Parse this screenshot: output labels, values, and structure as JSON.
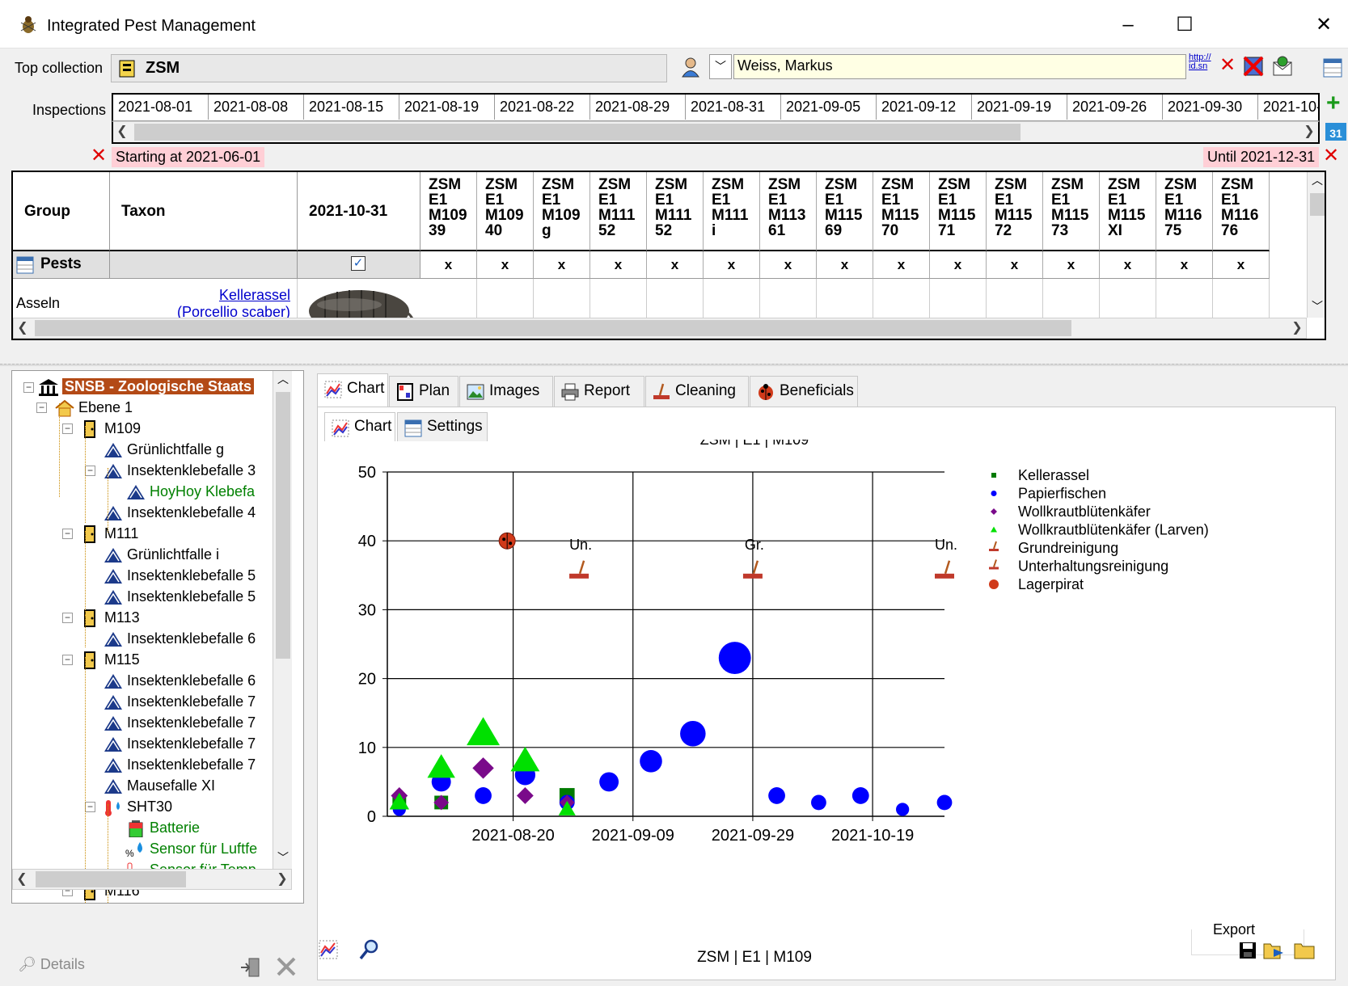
{
  "window": {
    "title": "Integrated Pest Management",
    "minimize": "–",
    "maximize": "☐",
    "close": "✕"
  },
  "top_collection": {
    "label": "Top collection",
    "value": "ZSM"
  },
  "user": {
    "value": "Weiss, Markus",
    "link_text": "http://\nid.sn"
  },
  "inspections": {
    "label": "Inspections",
    "dates": [
      "2021-08-01",
      "2021-08-08",
      "2021-08-15",
      "2021-08-19",
      "2021-08-22",
      "2021-08-29",
      "2021-08-31",
      "2021-09-05",
      "2021-09-12",
      "2021-09-19",
      "2021-09-26",
      "2021-09-30",
      "2021-10-"
    ]
  },
  "filter": {
    "start": "Starting at 2021-06-01",
    "end": "Until 2021-12-31"
  },
  "grid": {
    "col_group": "Group",
    "col_taxon": "Taxon",
    "col_date": "2021-10-31",
    "trap_columns": [
      "ZSM\nE1\nM109\n39",
      "ZSM\nE1\nM109\n40",
      "ZSM\nE1\nM109\ng",
      "ZSM\nE1\nM111\n52",
      "ZSM\nE1\nM111\n52",
      "ZSM\nE1\nM111\ni",
      "ZSM\nE1\nM113\n61",
      "ZSM\nE1\nM115\n69",
      "ZSM\nE1\nM115\n70",
      "ZSM\nE1\nM115\n71",
      "ZSM\nE1\nM115\n72",
      "ZSM\nE1\nM115\n73",
      "ZSM\nE1\nM115\nXI",
      "ZSM\nE1\nM116\n75",
      "ZSM\nE1\nM116\n76"
    ],
    "row_pests": "Pests",
    "x_mark": "x",
    "row1": {
      "group": "Asseln",
      "taxon": "Kellerassel",
      "taxon_sci": "(Porcellio scaber)"
    }
  },
  "tree": {
    "root": "SNSB - Zoologische Staats",
    "items": [
      {
        "label": "Ebene 1"
      },
      {
        "label": "M109"
      },
      {
        "label": "Grünlichtfalle g"
      },
      {
        "label": "Insektenklebefalle 3"
      },
      {
        "label": "HoyHoy Klebefa"
      },
      {
        "label": "Insektenklebefalle 4"
      },
      {
        "label": "M111"
      },
      {
        "label": "Grünlichtfalle i"
      },
      {
        "label": "Insektenklebefalle 5"
      },
      {
        "label": "Insektenklebefalle 5"
      },
      {
        "label": "M113"
      },
      {
        "label": "Insektenklebefalle 6"
      },
      {
        "label": "M115"
      },
      {
        "label": "Insektenklebefalle 6"
      },
      {
        "label": "Insektenklebefalle 7"
      },
      {
        "label": "Insektenklebefalle 7"
      },
      {
        "label": "Insektenklebefalle 7"
      },
      {
        "label": "Insektenklebefalle 7"
      },
      {
        "label": "Mausefalle XI"
      },
      {
        "label": "SHT30"
      },
      {
        "label": "Batterie"
      },
      {
        "label": "Sensor für Luftfe"
      },
      {
        "label": "Sensor für Temp"
      },
      {
        "label": "M116"
      }
    ],
    "details": "Details",
    "percent_glyph": "%",
    "celsius_glyph": "°C"
  },
  "tabs": [
    "Chart",
    "Plan",
    "Images",
    "Report",
    "Cleaning",
    "Beneficials"
  ],
  "subtabs": [
    "Chart",
    "Settings"
  ],
  "footer_caption": "ZSM | E1 | M109",
  "export_label": "Export",
  "icons": {
    "app": "bug-icon",
    "user": "person-icon",
    "collection": "collection-icon",
    "add": "plus-icon",
    "calendar": "calendar-icon",
    "delete": "delete-icon",
    "chart": "chart-icon",
    "zoom": "magnifier-icon",
    "save": "save-icon",
    "export": "export-icon",
    "folder": "folder-icon"
  },
  "colors": {
    "kellerassel": "#007a00",
    "papierfischen": "#0000ff",
    "wollkraut": "#7a0a8a",
    "larven": "#00e000",
    "broom": "#b35a1f",
    "lagerpirat": "#d03a1a",
    "pink": "#ffcfd6",
    "user_field": "#ffffe4"
  },
  "chart_data": {
    "type": "scatter",
    "title": "ZSM | E1 | M109",
    "xlabel": "",
    "ylabel": "",
    "xlim": [
      "2021-07-30",
      "2021-10-31"
    ],
    "ylim": [
      0,
      50
    ],
    "yticks": [
      0,
      10,
      20,
      30,
      40,
      50
    ],
    "xticks": [
      "2021-08-20",
      "2021-09-09",
      "2021-09-29",
      "2021-10-19"
    ],
    "grid": true,
    "legend_position": "right",
    "series": [
      {
        "name": "Kellerassel",
        "marker": "square",
        "points": [
          {
            "x": "2021-08-01",
            "y": 2
          },
          {
            "x": "2021-08-08",
            "y": 2
          },
          {
            "x": "2021-08-29",
            "y": 3
          }
        ]
      },
      {
        "name": "Papierfischen",
        "marker": "circle",
        "points": [
          {
            "x": "2021-08-01",
            "y": 1
          },
          {
            "x": "2021-08-08",
            "y": 5
          },
          {
            "x": "2021-08-15",
            "y": 3
          },
          {
            "x": "2021-08-22",
            "y": 6
          },
          {
            "x": "2021-08-29",
            "y": 2
          },
          {
            "x": "2021-09-05",
            "y": 5
          },
          {
            "x": "2021-09-12",
            "y": 8
          },
          {
            "x": "2021-09-19",
            "y": 12
          },
          {
            "x": "2021-09-26",
            "y": 23
          },
          {
            "x": "2021-10-03",
            "y": 3
          },
          {
            "x": "2021-10-10",
            "y": 2
          },
          {
            "x": "2021-10-17",
            "y": 3
          },
          {
            "x": "2021-10-24",
            "y": 1
          },
          {
            "x": "2021-10-31",
            "y": 2
          }
        ]
      },
      {
        "name": "Wollkrautblütenkäfer",
        "marker": "diamond",
        "points": [
          {
            "x": "2021-08-01",
            "y": 3
          },
          {
            "x": "2021-08-08",
            "y": 2
          },
          {
            "x": "2021-08-15",
            "y": 7
          },
          {
            "x": "2021-08-22",
            "y": 3
          },
          {
            "x": "2021-08-29",
            "y": 2
          }
        ]
      },
      {
        "name": "Wollkrautblütenkäfer (Larven)",
        "marker": "triangle",
        "points": [
          {
            "x": "2021-08-01",
            "y": 2
          },
          {
            "x": "2021-08-08",
            "y": 7
          },
          {
            "x": "2021-08-15",
            "y": 12
          },
          {
            "x": "2021-08-22",
            "y": 8
          },
          {
            "x": "2021-08-29",
            "y": 1
          }
        ]
      },
      {
        "name": "Grundreinigung",
        "marker": "broom",
        "points": [
          {
            "x": "2021-09-29",
            "y": 35,
            "label": "Gr."
          }
        ]
      },
      {
        "name": "Unterhaltungsreinigung",
        "marker": "broom",
        "points": [
          {
            "x": "2021-08-31",
            "y": 35,
            "label": "Un."
          },
          {
            "x": "2021-10-31",
            "y": 35,
            "label": "Un."
          }
        ]
      },
      {
        "name": "Lagerpirat",
        "marker": "ladybug",
        "points": [
          {
            "x": "2021-08-19",
            "y": 40
          }
        ]
      }
    ]
  }
}
